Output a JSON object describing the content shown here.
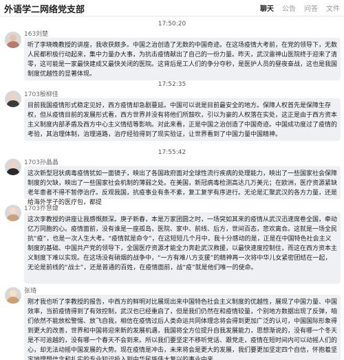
{
  "header": {
    "title": "外语学二网络党支部",
    "tabs": [
      "聊天",
      "公告",
      "问答",
      "文件"
    ],
    "active_tab": "聊天"
  },
  "messages": [
    {
      "timestamp": "17:50:20",
      "user": "163刘楚",
      "text": "听了李晓晚教授的讲座，我收获颇多。中国之治创造了无数的中国奇迹。在这场疫情大考前，在党的领导下，无数人民都积极行动起来，集中力量办大事，为抗击疫情献出了自己的一份力量。昨天，武汉雷神山医院终于迎来了清零，这可能是一家最快建成又最快关闭的医院。这背后是工人们的争分夺秒，是医护人员的昼夜奋战，这也是我国制度优越性的显著体现。"
    },
    {
      "timestamp": "17:52:35",
      "user": "1703殷柳佳",
      "text": "目前我国疫情形式稳定见好，西方疫情却急剧蔓延。中国可以说是目前最安全的地方。保障人权首先是保障生存权，但从疫情目前的发展形式看，西方世界并没有将他们所鼓吹，引以为豪的人权落在实处，这正是由于西方资本主义制度内部矛盾及西方中心主义情结等影响。对此来看，正是中国之治创造了中国奇迹。中国成功度过了疫情的考验，其治理体制，治理道路，治疗经验得到了现实验证，让世界看到了中国力量中国精神。"
    },
    {
      "timestamp": "17:55:42",
      "user": "1703孙晶晶",
      "text": "这次新型冠状病毒疫情犹如一面镜子，映出了各国政府面对全球性流行疾病的处理能力，映出了一些国家社会保障制度的欠缺，映出了一些国家社会机制的薄弱之处。在美国，新冠病毒检测高达几万美元；在欧洲，医疗资源紧缺老年患者不得不暂停治疗。反观我国，抗疫事业有条不紊，复工复学有序进行。无论是汇聚武汉的各方力量，还是给海外学子的医疗包，都提"
    },
    {
      "timestamp": "",
      "user": "1703乔慧婕",
      "text": "这次李教授的讲座让我感慨颇深。庚子新春，本是万家团圆之时，一场突如其来的疫情从武汉迅速席卷全国，牵动亿万同胞的心。疫情面前，没有谁是一座孤岛，医院、家中、前线、后方，世间百态，悲欢离合。这就是一场全民抗“疫”，也是一次人生大考。“疫情就是命令”，在这短短几个月中，我十分感动的是，正是在中国特色社会主义制度的基础、中国共产党的领导下，全国医疗资源才能全力奔赴武汉救援，以最快速度控制住，而这在西方资本主义制度下难以实现。在这场没有硝烟的战争中，“一方有难八方支援”的精神再一次将中华儿女紧密团结在一起，无论是前线的“战士”，还是普通的百姓，在疫情面前，战“疫”就是他们唯一的使命。"
    },
    {
      "timestamp": "",
      "user": "张琦",
      "text": "刚才我也听了李教授的报告，中西方的鲜明对比展现出来中国特色社会主义制度的优越性，展现了中国力量、中国效率，当前疫情得到了有效控制，武汉也已经重启了，但是我们仍然在和疫情较量，个别地方数据出现了反弹，咱们依然不能放松警惕、放飞自我，相信在疫情过后人类命运共同体理念将会得到更加广泛的认可，中国国际形象得到更大的改善，世界和中国将迎来新的发展机遇，我国将全方位提升自我发展能力，思想渐说的，没有哪一个冬天是不可逾越的，没有哪一个春天不会到来。所以我们要坚定不移听党话、跟党走，疫情在短时间内可以动摇人们的心，却无法动摇中国发展的大势。现在疫情是冲击，未来将会是更大的发展，我们要更加坚定四个自信，怀抱着坚定地理想信念和扎实的专业知识投入到中华民族伟大复兴的事业中来。"
    }
  ],
  "avatar_colors": [
    "#b97a6a",
    "#3a3a3a",
    "#2a2a2a",
    "#c9a27a",
    "#d0a070"
  ]
}
